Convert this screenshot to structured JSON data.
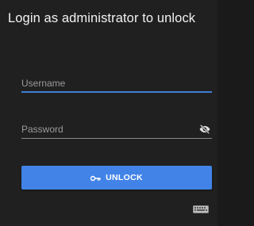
{
  "dialog": {
    "title": "Login as administrator to unlock"
  },
  "username": {
    "placeholder": "Username",
    "value": ""
  },
  "password": {
    "placeholder": "Password",
    "value": "",
    "visibility_icon": "eye-off-icon"
  },
  "unlock_button": {
    "label": "UNLOCK",
    "icon": "key-icon"
  },
  "keyboard_icon": "keyboard-icon",
  "colors": {
    "background": "#202020",
    "accent": "#4283e8",
    "focus_line": "#3f7fd6"
  }
}
